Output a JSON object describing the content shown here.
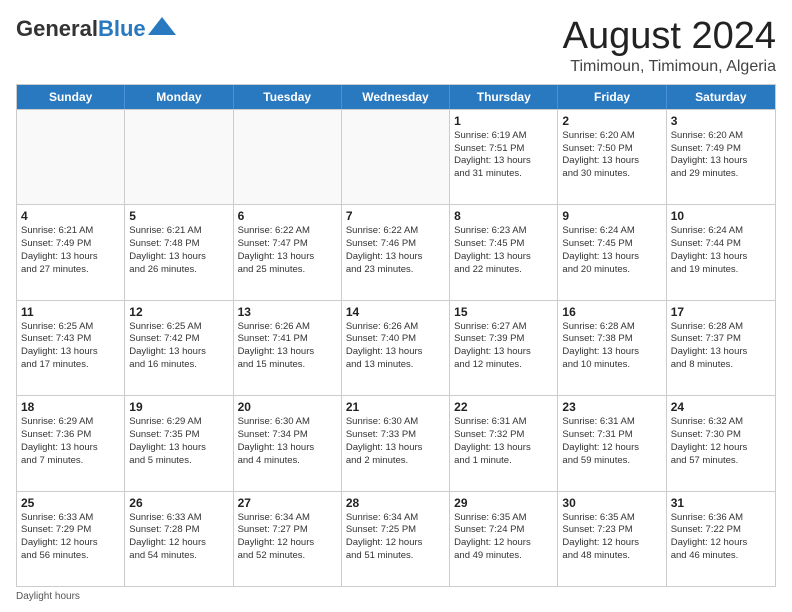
{
  "logo": {
    "general": "General",
    "blue": "Blue"
  },
  "title": "August 2024",
  "subtitle": "Timimoun, Timimoun, Algeria",
  "days": [
    "Sunday",
    "Monday",
    "Tuesday",
    "Wednesday",
    "Thursday",
    "Friday",
    "Saturday"
  ],
  "footer": "Daylight hours",
  "weeks": [
    [
      {
        "day": "",
        "lines": []
      },
      {
        "day": "",
        "lines": []
      },
      {
        "day": "",
        "lines": []
      },
      {
        "day": "",
        "lines": []
      },
      {
        "day": "1",
        "lines": [
          "Sunrise: 6:19 AM",
          "Sunset: 7:51 PM",
          "Daylight: 13 hours",
          "and 31 minutes."
        ]
      },
      {
        "day": "2",
        "lines": [
          "Sunrise: 6:20 AM",
          "Sunset: 7:50 PM",
          "Daylight: 13 hours",
          "and 30 minutes."
        ]
      },
      {
        "day": "3",
        "lines": [
          "Sunrise: 6:20 AM",
          "Sunset: 7:49 PM",
          "Daylight: 13 hours",
          "and 29 minutes."
        ]
      }
    ],
    [
      {
        "day": "4",
        "lines": [
          "Sunrise: 6:21 AM",
          "Sunset: 7:49 PM",
          "Daylight: 13 hours",
          "and 27 minutes."
        ]
      },
      {
        "day": "5",
        "lines": [
          "Sunrise: 6:21 AM",
          "Sunset: 7:48 PM",
          "Daylight: 13 hours",
          "and 26 minutes."
        ]
      },
      {
        "day": "6",
        "lines": [
          "Sunrise: 6:22 AM",
          "Sunset: 7:47 PM",
          "Daylight: 13 hours",
          "and 25 minutes."
        ]
      },
      {
        "day": "7",
        "lines": [
          "Sunrise: 6:22 AM",
          "Sunset: 7:46 PM",
          "Daylight: 13 hours",
          "and 23 minutes."
        ]
      },
      {
        "day": "8",
        "lines": [
          "Sunrise: 6:23 AM",
          "Sunset: 7:45 PM",
          "Daylight: 13 hours",
          "and 22 minutes."
        ]
      },
      {
        "day": "9",
        "lines": [
          "Sunrise: 6:24 AM",
          "Sunset: 7:45 PM",
          "Daylight: 13 hours",
          "and 20 minutes."
        ]
      },
      {
        "day": "10",
        "lines": [
          "Sunrise: 6:24 AM",
          "Sunset: 7:44 PM",
          "Daylight: 13 hours",
          "and 19 minutes."
        ]
      }
    ],
    [
      {
        "day": "11",
        "lines": [
          "Sunrise: 6:25 AM",
          "Sunset: 7:43 PM",
          "Daylight: 13 hours",
          "and 17 minutes."
        ]
      },
      {
        "day": "12",
        "lines": [
          "Sunrise: 6:25 AM",
          "Sunset: 7:42 PM",
          "Daylight: 13 hours",
          "and 16 minutes."
        ]
      },
      {
        "day": "13",
        "lines": [
          "Sunrise: 6:26 AM",
          "Sunset: 7:41 PM",
          "Daylight: 13 hours",
          "and 15 minutes."
        ]
      },
      {
        "day": "14",
        "lines": [
          "Sunrise: 6:26 AM",
          "Sunset: 7:40 PM",
          "Daylight: 13 hours",
          "and 13 minutes."
        ]
      },
      {
        "day": "15",
        "lines": [
          "Sunrise: 6:27 AM",
          "Sunset: 7:39 PM",
          "Daylight: 13 hours",
          "and 12 minutes."
        ]
      },
      {
        "day": "16",
        "lines": [
          "Sunrise: 6:28 AM",
          "Sunset: 7:38 PM",
          "Daylight: 13 hours",
          "and 10 minutes."
        ]
      },
      {
        "day": "17",
        "lines": [
          "Sunrise: 6:28 AM",
          "Sunset: 7:37 PM",
          "Daylight: 13 hours",
          "and 8 minutes."
        ]
      }
    ],
    [
      {
        "day": "18",
        "lines": [
          "Sunrise: 6:29 AM",
          "Sunset: 7:36 PM",
          "Daylight: 13 hours",
          "and 7 minutes."
        ]
      },
      {
        "day": "19",
        "lines": [
          "Sunrise: 6:29 AM",
          "Sunset: 7:35 PM",
          "Daylight: 13 hours",
          "and 5 minutes."
        ]
      },
      {
        "day": "20",
        "lines": [
          "Sunrise: 6:30 AM",
          "Sunset: 7:34 PM",
          "Daylight: 13 hours",
          "and 4 minutes."
        ]
      },
      {
        "day": "21",
        "lines": [
          "Sunrise: 6:30 AM",
          "Sunset: 7:33 PM",
          "Daylight: 13 hours",
          "and 2 minutes."
        ]
      },
      {
        "day": "22",
        "lines": [
          "Sunrise: 6:31 AM",
          "Sunset: 7:32 PM",
          "Daylight: 13 hours",
          "and 1 minute."
        ]
      },
      {
        "day": "23",
        "lines": [
          "Sunrise: 6:31 AM",
          "Sunset: 7:31 PM",
          "Daylight: 12 hours",
          "and 59 minutes."
        ]
      },
      {
        "day": "24",
        "lines": [
          "Sunrise: 6:32 AM",
          "Sunset: 7:30 PM",
          "Daylight: 12 hours",
          "and 57 minutes."
        ]
      }
    ],
    [
      {
        "day": "25",
        "lines": [
          "Sunrise: 6:33 AM",
          "Sunset: 7:29 PM",
          "Daylight: 12 hours",
          "and 56 minutes."
        ]
      },
      {
        "day": "26",
        "lines": [
          "Sunrise: 6:33 AM",
          "Sunset: 7:28 PM",
          "Daylight: 12 hours",
          "and 54 minutes."
        ]
      },
      {
        "day": "27",
        "lines": [
          "Sunrise: 6:34 AM",
          "Sunset: 7:27 PM",
          "Daylight: 12 hours",
          "and 52 minutes."
        ]
      },
      {
        "day": "28",
        "lines": [
          "Sunrise: 6:34 AM",
          "Sunset: 7:25 PM",
          "Daylight: 12 hours",
          "and 51 minutes."
        ]
      },
      {
        "day": "29",
        "lines": [
          "Sunrise: 6:35 AM",
          "Sunset: 7:24 PM",
          "Daylight: 12 hours",
          "and 49 minutes."
        ]
      },
      {
        "day": "30",
        "lines": [
          "Sunrise: 6:35 AM",
          "Sunset: 7:23 PM",
          "Daylight: 12 hours",
          "and 48 minutes."
        ]
      },
      {
        "day": "31",
        "lines": [
          "Sunrise: 6:36 AM",
          "Sunset: 7:22 PM",
          "Daylight: 12 hours",
          "and 46 minutes."
        ]
      }
    ]
  ]
}
